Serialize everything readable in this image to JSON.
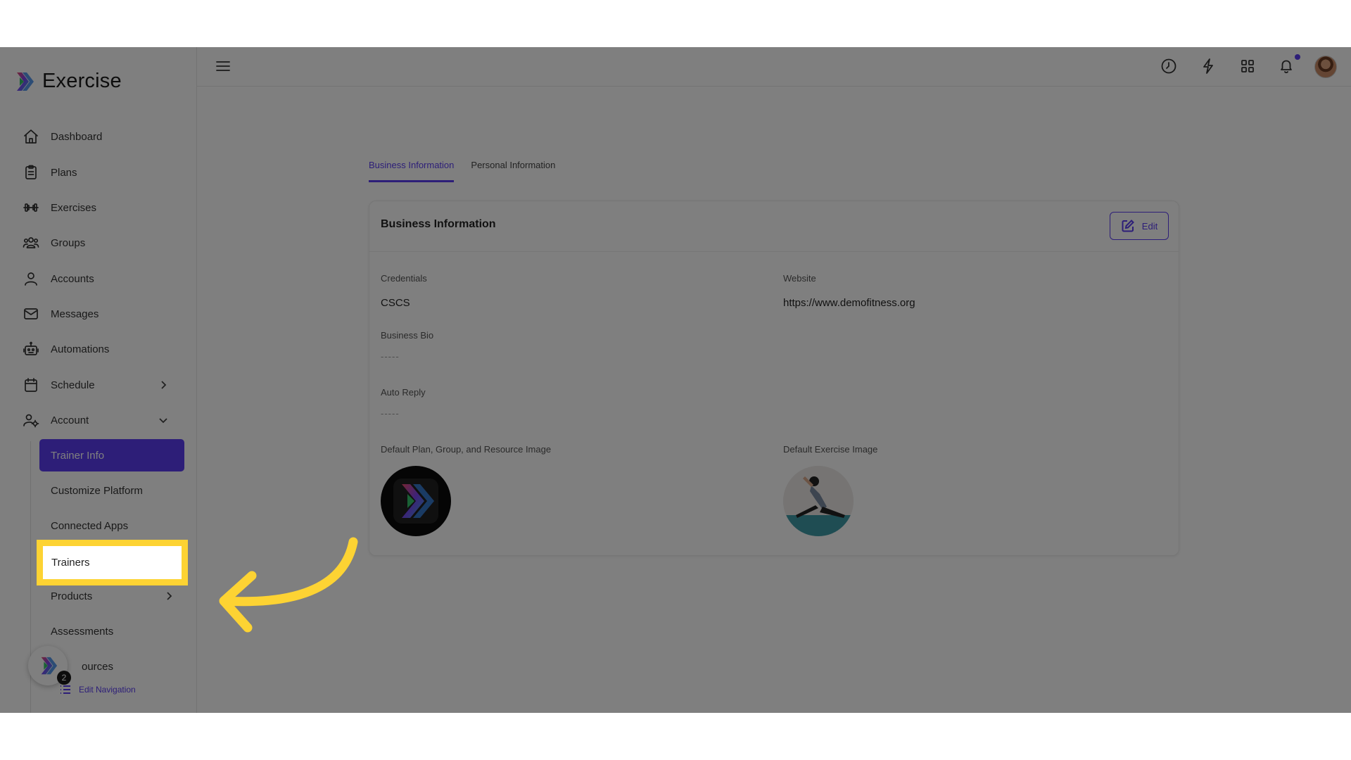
{
  "brand": {
    "name": "Exercise"
  },
  "sidebar": {
    "items": [
      {
        "label": "Dashboard",
        "icon": "home-icon"
      },
      {
        "label": "Plans",
        "icon": "clipboard-icon"
      },
      {
        "label": "Exercises",
        "icon": "dumbbell-icon"
      },
      {
        "label": "Groups",
        "icon": "users-icon"
      },
      {
        "label": "Accounts",
        "icon": "user-icon"
      },
      {
        "label": "Messages",
        "icon": "mail-icon"
      },
      {
        "label": "Automations",
        "icon": "robot-icon"
      },
      {
        "label": "Schedule",
        "icon": "calendar-icon"
      },
      {
        "label": "Account",
        "icon": "user-gear-icon"
      }
    ],
    "account_sub": [
      {
        "label": "Trainer Info"
      },
      {
        "label": "Customize Platform"
      },
      {
        "label": "Connected Apps"
      },
      {
        "label": "Trainers"
      },
      {
        "label": "Products"
      },
      {
        "label": "Assessments"
      },
      {
        "label": "ources"
      }
    ],
    "fab_badge": "2",
    "edit_navigation": "Edit Navigation"
  },
  "tabs": [
    {
      "label": "Business Information",
      "active": true
    },
    {
      "label": "Personal Information",
      "active": false
    }
  ],
  "card": {
    "title": "Business Information",
    "edit_label": "Edit",
    "credentials_label": "Credentials",
    "credentials_value": "CSCS",
    "website_label": "Website",
    "website_value": "https://www.demofitness.org",
    "bio_label": "Business Bio",
    "bio_value": "-----",
    "auto_reply_label": "Auto Reply",
    "auto_reply_value": "-----",
    "default_plan_image_label": "Default Plan, Group, and Resource Image",
    "default_exercise_image_label": "Default Exercise Image"
  },
  "colors": {
    "accent": "#5a3df0",
    "highlight": "#fdd333",
    "overlay": "rgba(0,0,0,0.5)"
  }
}
